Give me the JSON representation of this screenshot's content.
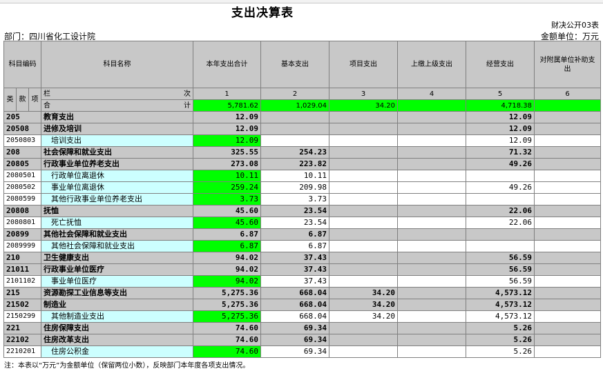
{
  "page": {
    "title": "支出决算表",
    "table_no": "财决公开03表",
    "department": "部门：四川省化工设计院",
    "unit": "金额单位：万元",
    "note": "注：本表以“万元”为金额单位（保留两位小数），反映部门本年度各项支出情况。"
  },
  "header": {
    "code": "科目编码",
    "name": "科目名称",
    "total": "本年支出合计",
    "basic": "基本支出",
    "project": "项目支出",
    "upper": "上缴上级支出",
    "business": "经营支出",
    "subsidy": "对附属单位补助支出",
    "lei": "类",
    "kuan": "款",
    "xiang": "项",
    "lan": "栏",
    "ci": "次",
    "he": "合",
    "ji": "计",
    "col_nums": [
      "1",
      "2",
      "3",
      "4",
      "5",
      "6"
    ]
  },
  "totals": {
    "total": "5,781.62",
    "basic": "1,029.04",
    "project": "34.20",
    "upper": "",
    "business": "4,718.38",
    "subsidy": ""
  },
  "rows": [
    {
      "code": "205",
      "name": "教育支出",
      "total": "12.09",
      "basic": "",
      "project": "",
      "upper": "",
      "business": "12.09",
      "subsidy": ""
    },
    {
      "code": "20508",
      "name": "进修及培训",
      "total": "12.09",
      "basic": "",
      "project": "",
      "upper": "",
      "business": "12.09",
      "subsidy": ""
    },
    {
      "code": "2050803",
      "name": "培训支出",
      "total": "12.09",
      "basic": "",
      "project": "",
      "upper": "",
      "business": "12.09",
      "subsidy": ""
    },
    {
      "code": "208",
      "name": "社会保障和就业支出",
      "total": "325.55",
      "basic": "254.23",
      "project": "",
      "upper": "",
      "business": "71.32",
      "subsidy": ""
    },
    {
      "code": "20805",
      "name": "行政事业单位养老支出",
      "total": "273.08",
      "basic": "223.82",
      "project": "",
      "upper": "",
      "business": "49.26",
      "subsidy": ""
    },
    {
      "code": "2080501",
      "name": "行政单位离退休",
      "total": "10.11",
      "basic": "10.11",
      "project": "",
      "upper": "",
      "business": "",
      "subsidy": ""
    },
    {
      "code": "2080502",
      "name": "事业单位离退休",
      "total": "259.24",
      "basic": "209.98",
      "project": "",
      "upper": "",
      "business": "49.26",
      "subsidy": ""
    },
    {
      "code": "2080599",
      "name": "其他行政事业单位养老支出",
      "total": "3.73",
      "basic": "3.73",
      "project": "",
      "upper": "",
      "business": "",
      "subsidy": ""
    },
    {
      "code": "20808",
      "name": "抚恤",
      "total": "45.60",
      "basic": "23.54",
      "project": "",
      "upper": "",
      "business": "22.06",
      "subsidy": ""
    },
    {
      "code": "2080801",
      "name": "死亡抚恤",
      "total": "45.60",
      "basic": "23.54",
      "project": "",
      "upper": "",
      "business": "22.06",
      "subsidy": ""
    },
    {
      "code": "20899",
      "name": "其他社会保障和就业支出",
      "total": "6.87",
      "basic": "6.87",
      "project": "",
      "upper": "",
      "business": "",
      "subsidy": ""
    },
    {
      "code": "2089999",
      "name": "其他社会保障和就业支出",
      "total": "6.87",
      "basic": "6.87",
      "project": "",
      "upper": "",
      "business": "",
      "subsidy": ""
    },
    {
      "code": "210",
      "name": "卫生健康支出",
      "total": "94.02",
      "basic": "37.43",
      "project": "",
      "upper": "",
      "business": "56.59",
      "subsidy": ""
    },
    {
      "code": "21011",
      "name": "行政事业单位医疗",
      "total": "94.02",
      "basic": "37.43",
      "project": "",
      "upper": "",
      "business": "56.59",
      "subsidy": ""
    },
    {
      "code": "2101102",
      "name": "事业单位医疗",
      "total": "94.02",
      "basic": "37.43",
      "project": "",
      "upper": "",
      "business": "56.59",
      "subsidy": ""
    },
    {
      "code": "215",
      "name": "资源勘探工业信息等支出",
      "total": "5,275.36",
      "basic": "668.04",
      "project": "34.20",
      "upper": "",
      "business": "4,573.12",
      "subsidy": ""
    },
    {
      "code": "21502",
      "name": "制造业",
      "total": "5,275.36",
      "basic": "668.04",
      "project": "34.20",
      "upper": "",
      "business": "4,573.12",
      "subsidy": ""
    },
    {
      "code": "2150299",
      "name": "其他制造业支出",
      "total": "5,275.36",
      "basic": "668.04",
      "project": "34.20",
      "upper": "",
      "business": "4,573.12",
      "subsidy": ""
    },
    {
      "code": "221",
      "name": "住房保障支出",
      "total": "74.60",
      "basic": "69.34",
      "project": "",
      "upper": "",
      "business": "5.26",
      "subsidy": ""
    },
    {
      "code": "22102",
      "name": "住房改革支出",
      "total": "74.60",
      "basic": "69.34",
      "project": "",
      "upper": "",
      "business": "5.26",
      "subsidy": ""
    },
    {
      "code": "2210201",
      "name": "住房公积金",
      "total": "74.60",
      "basic": "69.34",
      "project": "",
      "upper": "",
      "business": "5.26",
      "subsidy": ""
    }
  ]
}
